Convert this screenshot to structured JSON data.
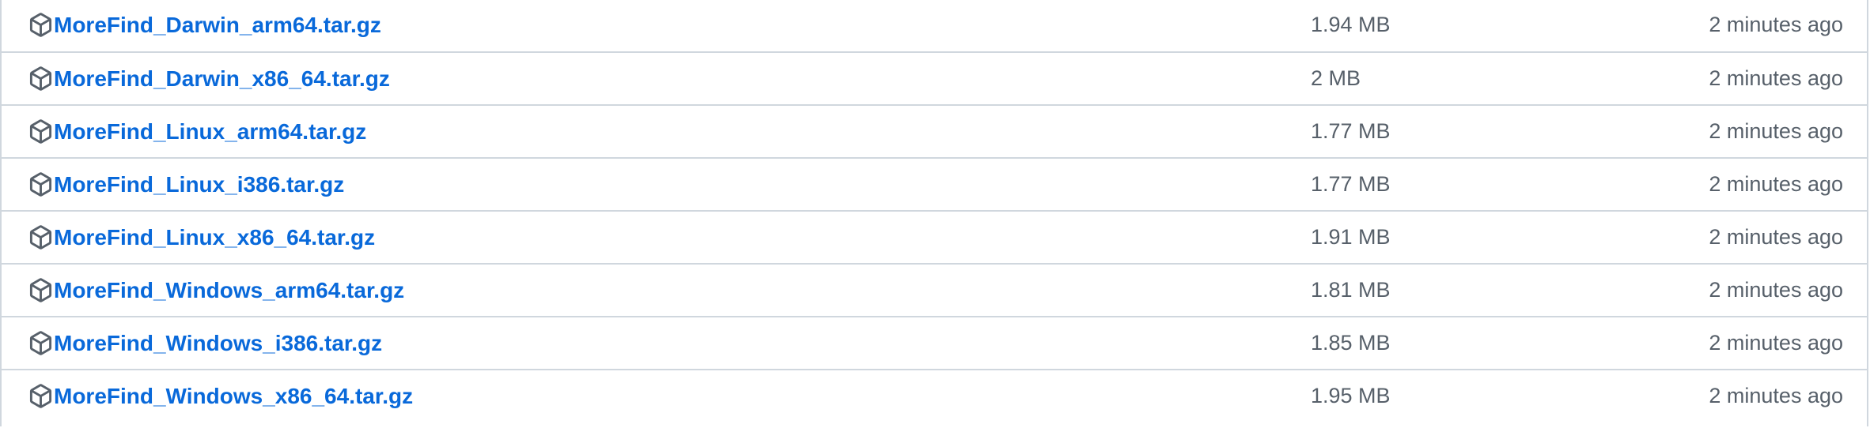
{
  "assets": [
    {
      "name": "MoreFind_Darwin_arm64.tar.gz",
      "size": "1.94 MB",
      "time": "2 minutes ago",
      "icon": "package-icon"
    },
    {
      "name": "MoreFind_Darwin_x86_64.tar.gz",
      "size": "2 MB",
      "time": "2 minutes ago",
      "icon": "package-icon"
    },
    {
      "name": "MoreFind_Linux_arm64.tar.gz",
      "size": "1.77 MB",
      "time": "2 minutes ago",
      "icon": "package-icon"
    },
    {
      "name": "MoreFind_Linux_i386.tar.gz",
      "size": "1.77 MB",
      "time": "2 minutes ago",
      "icon": "package-icon"
    },
    {
      "name": "MoreFind_Linux_x86_64.tar.gz",
      "size": "1.91 MB",
      "time": "2 minutes ago",
      "icon": "package-icon"
    },
    {
      "name": "MoreFind_Windows_arm64.tar.gz",
      "size": "1.81 MB",
      "time": "2 minutes ago",
      "icon": "package-icon"
    },
    {
      "name": "MoreFind_Windows_i386.tar.gz",
      "size": "1.85 MB",
      "time": "2 minutes ago",
      "icon": "package-icon"
    },
    {
      "name": "MoreFind_Windows_x86_64.tar.gz",
      "size": "1.95 MB",
      "time": "2 minutes ago",
      "icon": "package-icon"
    }
  ],
  "colors": {
    "link": "#0969da",
    "muted_text": "#57606a",
    "border": "#d0d7de",
    "icon": "#57606a"
  }
}
